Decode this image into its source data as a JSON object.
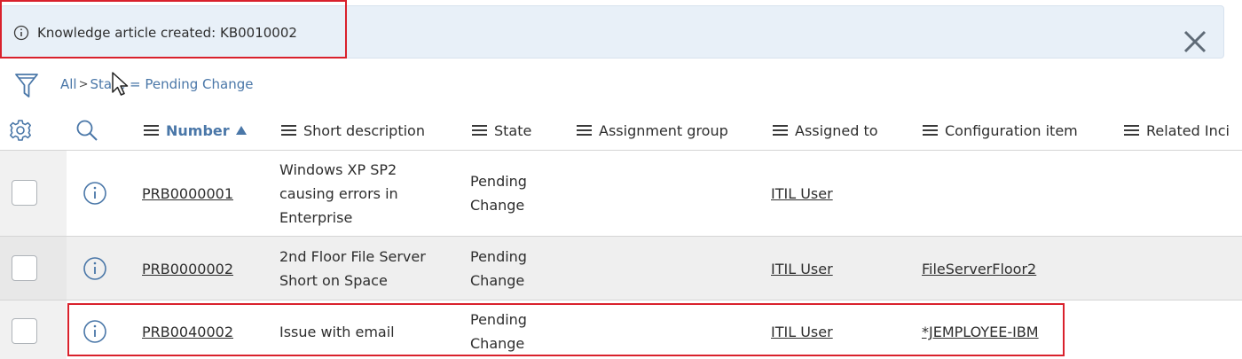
{
  "banner": {
    "message": "Knowledge article created: KB0010002",
    "info_icon": "info-circle-icon",
    "close_icon": "close-icon"
  },
  "breadcrumb": {
    "all": "All",
    "separator": ">",
    "condition": "State = Pending Change"
  },
  "table": {
    "columns": [
      "Number",
      "Short description",
      "State",
      "Assignment group",
      "Assigned to",
      "Configuration item",
      "Related Inci"
    ],
    "sort_column": "Number",
    "sort_direction": "ascending",
    "rows": [
      {
        "number": "PRB0000001",
        "short_description_lines": [
          "Windows XP SP2",
          "causing errors in",
          "Enterprise"
        ],
        "state_lines": [
          "Pending",
          "Change"
        ],
        "assignment_group": "",
        "assigned_to": "ITIL User",
        "configuration_item": ""
      },
      {
        "number": "PRB0000002",
        "short_description_lines": [
          "2nd Floor File Server",
          "Short on Space"
        ],
        "state_lines": [
          "Pending",
          "Change"
        ],
        "assignment_group": "",
        "assigned_to": "ITIL User",
        "configuration_item": "FileServerFloor2"
      },
      {
        "number": "PRB0040002",
        "short_description_lines": [
          "Issue with email"
        ],
        "state_lines": [
          "Pending",
          "Change"
        ],
        "assignment_group": "",
        "assigned_to": "ITIL User",
        "configuration_item": "*JEMPLOYEE-IBM"
      }
    ]
  },
  "colors": {
    "banner_bg": "#e8f0f8",
    "highlight": "#d9212c",
    "link_blue": "#4a77a8",
    "row_shade": "#efefef"
  }
}
